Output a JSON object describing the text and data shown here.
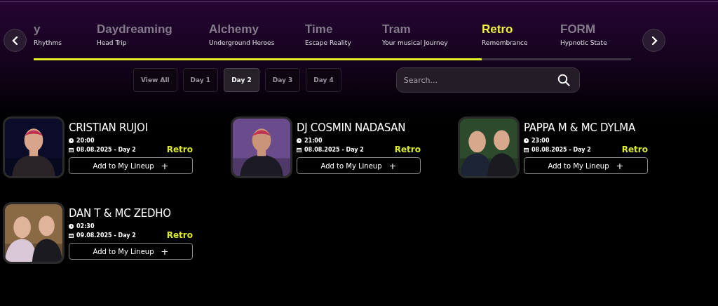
{
  "stages": {
    "tabs": [
      {
        "name": "y",
        "subtitle": "Rhythms",
        "selected": false
      },
      {
        "name": "Daydreaming",
        "subtitle": "Head Trip",
        "selected": false
      },
      {
        "name": "Alchemy",
        "subtitle": "Underground Heroes",
        "selected": false
      },
      {
        "name": "Time",
        "subtitle": "Escape Reality",
        "selected": false
      },
      {
        "name": "Tram",
        "subtitle": "Your musical Journey",
        "selected": false
      },
      {
        "name": "Retro",
        "subtitle": "Remembrance",
        "selected": true
      },
      {
        "name": "FORM",
        "subtitle": "Hypnotic State",
        "selected": false
      }
    ],
    "progress": {
      "level": 0.75
    }
  },
  "days": [
    {
      "label": "View All",
      "selected": false
    },
    {
      "label": "Day 1",
      "selected": false
    },
    {
      "label": "Day 2",
      "selected": true
    },
    {
      "label": "Day 3",
      "selected": false
    },
    {
      "label": "Day 4",
      "selected": false
    }
  ],
  "search": {
    "placeholder": "Search..."
  },
  "artists": [
    {
      "name": "CRISTIAN RUJOI",
      "time": "20:00",
      "date": "08.08.2025 - Day 2",
      "stage": "Retro",
      "button": "Add to My Lineup",
      "action": "+"
    },
    {
      "name": "DJ COSMIN NADASAN",
      "time": "21:00",
      "date": "08.08.2025 - Day 2",
      "stage": "Retro",
      "button": "Add to My Lineup",
      "action": "+"
    },
    {
      "name": "PAPPA M & MC DYLMA",
      "time": "23:00",
      "date": "08.08.2025 - Day 2",
      "stage": "Retro",
      "button": "Add to My Lineup",
      "action": "+"
    },
    {
      "name": "DAN T & MC ZEDHO",
      "time": "02:30",
      "date": "09.08.2025 - Day 2",
      "stage": "Retro",
      "button": "Add to My Lineup",
      "action": "+"
    }
  ]
}
